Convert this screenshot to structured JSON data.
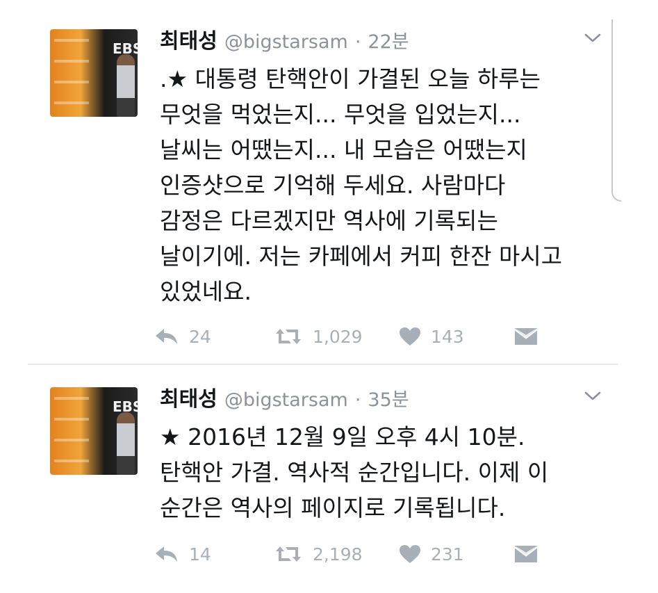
{
  "tweets": [
    {
      "name": "최태성",
      "handle": "@bigstarsam",
      "separator": "·",
      "time": "22분",
      "text": ".★ 대통령 탄핵안이 가결된 오늘 하루는\n무엇을 먹었는지... 무엇을 입었는지...\n날씨는 어땠는지... 내 모습은 어땠는지\n인증샷으로 기억해 두세요. 사람마다\n감정은 다르겠지만 역사에 기록되는\n날이기에. 저는 카페에서 커피 한잔 마시고\n있었네요.",
      "replies": "24",
      "retweets": "1,029",
      "likes": "143",
      "avatar_text": "EBS"
    },
    {
      "name": "최태성",
      "handle": "@bigstarsam",
      "separator": "·",
      "time": "35분",
      "text": "★ 2016년 12월 9일 오후 4시 10분.\n탄핵안 가결. 역사적 순간입니다. 이제 이\n순간은 역사의 페이지로 기록됩니다.",
      "replies": "14",
      "retweets": "2,198",
      "likes": "231",
      "avatar_text": "EBS"
    }
  ],
  "icons": {
    "reply": "reply-icon",
    "retweet": "retweet-icon",
    "like": "heart-icon",
    "dm": "envelope-icon",
    "menu": "chevron-down-icon"
  },
  "colors": {
    "text": "#14171a",
    "muted": "#8a939c",
    "action": "#a7b0b8",
    "divider": "#e6ecf0"
  }
}
